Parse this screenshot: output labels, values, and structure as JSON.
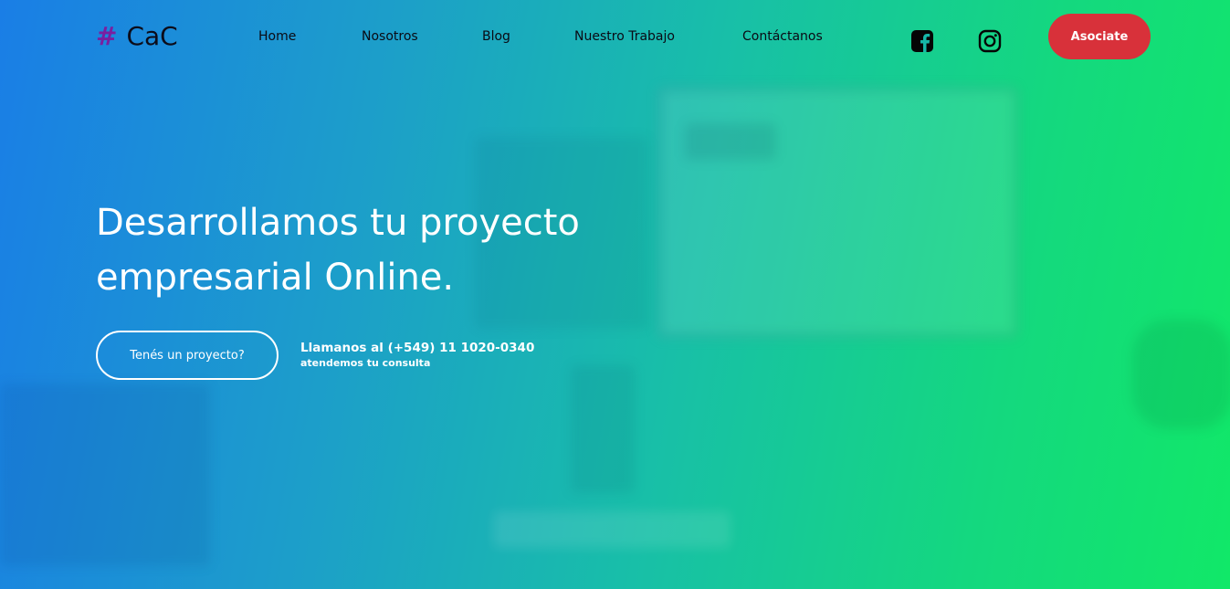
{
  "header": {
    "logo": {
      "symbol": "#",
      "text": "CaC"
    },
    "nav": [
      {
        "label": "Home"
      },
      {
        "label": "Nosotros"
      },
      {
        "label": "Blog"
      },
      {
        "label": "Nuestro Trabajo"
      },
      {
        "label": "Contáctanos"
      }
    ],
    "social": [
      {
        "icon": "facebook-icon"
      },
      {
        "icon": "instagram-icon"
      }
    ],
    "cta_label": "Asociate"
  },
  "hero": {
    "title_line1": "Desarrollamos tu proyecto",
    "title_line2": "empresarial Online.",
    "button_label": "Tenés un proyecto?",
    "phone_text": "Llamanos al (+549) 11 1020-0340",
    "phone_subtext": "atendemos tu consulta"
  },
  "colors": {
    "gradient_start": "#1a7ee6",
    "gradient_end": "#11e868",
    "accent_red": "#d8313a",
    "logo_hash": "#7a1fa0"
  }
}
